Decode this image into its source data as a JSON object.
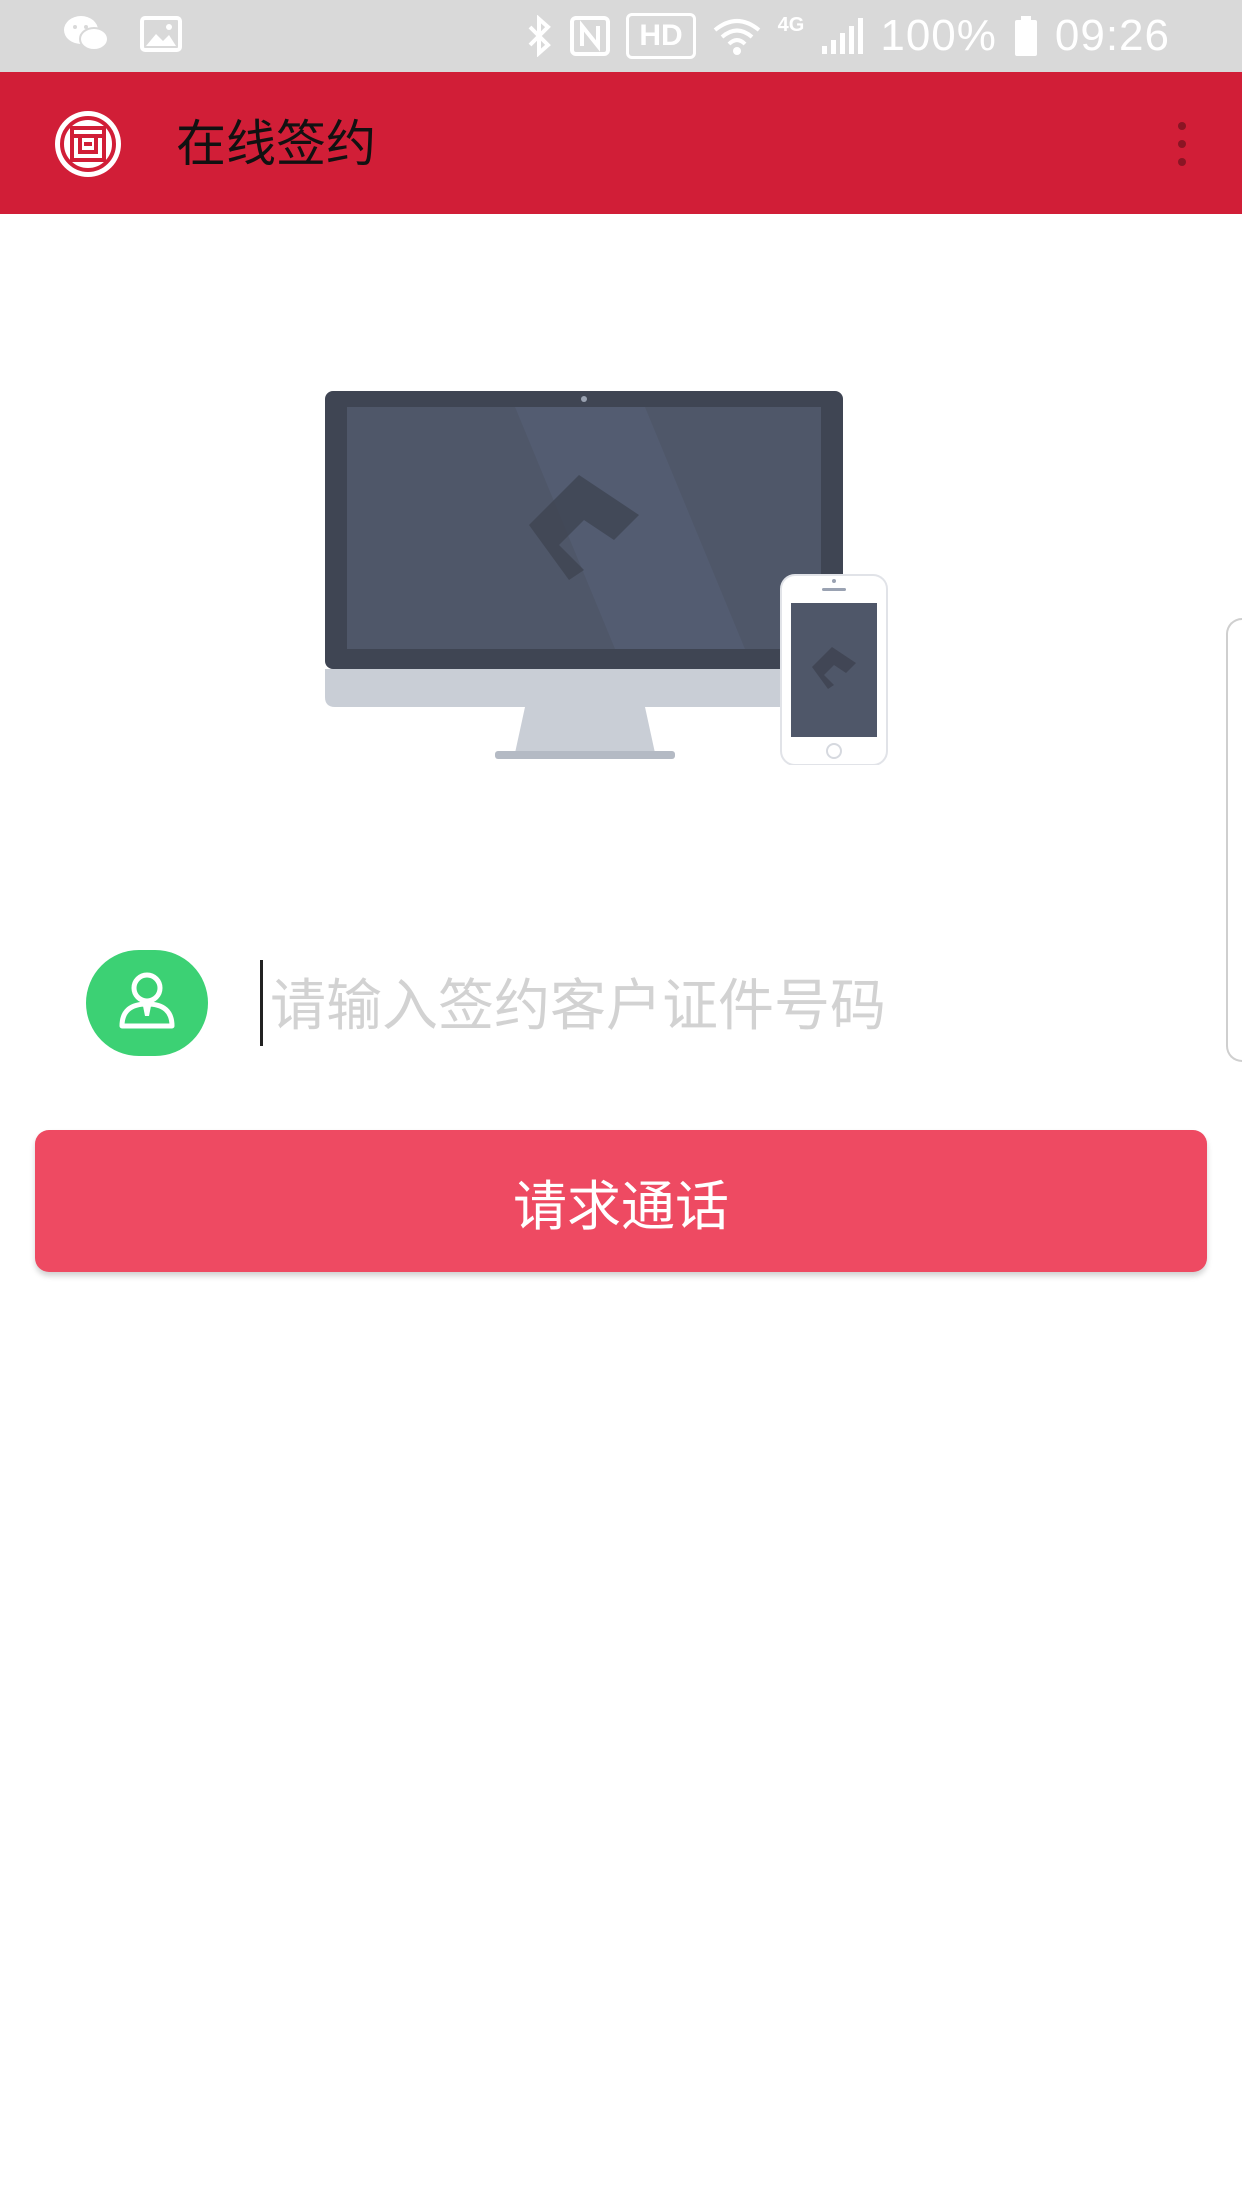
{
  "status_bar": {
    "battery": "100%",
    "time": "09:26",
    "hd_badge": "HD",
    "network": "4G",
    "icons": [
      "wechat-icon",
      "image-icon",
      "bluetooth-icon",
      "nfc-icon",
      "hd-icon",
      "wifi-icon",
      "signal-icon",
      "battery-icon"
    ]
  },
  "app_bar": {
    "title": "在线签约",
    "logo_icon": "bank-logo-icon",
    "menu_icon": "more-vert-icon"
  },
  "illustration": {
    "icon": "desktop-and-phone-illustration"
  },
  "id_input": {
    "placeholder": "请输入签约客户证件号码",
    "value": "",
    "icon": "user-icon"
  },
  "call_button": {
    "label": "请求通话"
  },
  "colors": {
    "status_bar": "#d9d9d9",
    "app_bar": "#d11e37",
    "button": "#ee4a62",
    "user_icon_bg": "#3cd174",
    "placeholder": "#d2d2d2"
  }
}
